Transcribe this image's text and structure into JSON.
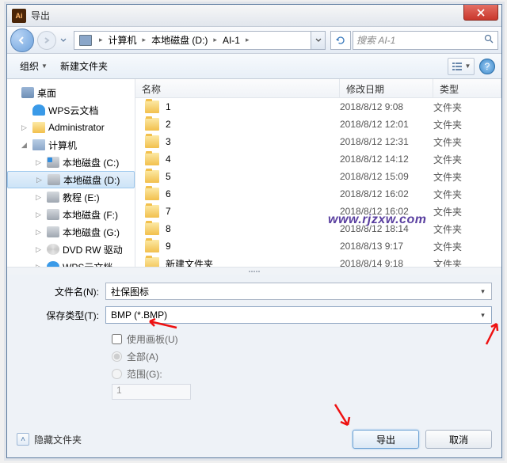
{
  "titlebar": {
    "title": "导出",
    "app_icon_text": "Ai"
  },
  "breadcrumb": {
    "seg1": "计算机",
    "seg2": "本地磁盘 (D:)",
    "seg3": "AI-1"
  },
  "search": {
    "placeholder": "搜索 AI-1"
  },
  "toolbar": {
    "organize": "组织",
    "new_folder": "新建文件夹",
    "help": "?"
  },
  "columns": {
    "name": "名称",
    "date": "修改日期",
    "type": "类型"
  },
  "sidebar": {
    "items": [
      {
        "label": "桌面",
        "icon": "ico-desktop",
        "lvl": "",
        "tri": ""
      },
      {
        "label": "WPS云文档",
        "icon": "ico-cloud",
        "lvl": "lvl1",
        "tri": ""
      },
      {
        "label": "Administrator",
        "icon": "ico-folder",
        "lvl": "lvl1",
        "tri": "▷"
      },
      {
        "label": "计算机",
        "icon": "ico-computer",
        "lvl": "lvl1",
        "tri": "◢"
      },
      {
        "label": "本地磁盘 (C:)",
        "icon": "ico-drive-win",
        "lvl": "lvl2",
        "tri": "▷"
      },
      {
        "label": "本地磁盘 (D:)",
        "icon": "ico-drive",
        "lvl": "lvl2",
        "tri": "▷",
        "sel": true
      },
      {
        "label": "教程 (E:)",
        "icon": "ico-drive",
        "lvl": "lvl2",
        "tri": "▷"
      },
      {
        "label": "本地磁盘 (F:)",
        "icon": "ico-drive",
        "lvl": "lvl2",
        "tri": "▷"
      },
      {
        "label": "本地磁盘 (G:)",
        "icon": "ico-drive",
        "lvl": "lvl2",
        "tri": "▷"
      },
      {
        "label": "DVD RW 驱动",
        "icon": "ico-dvd",
        "lvl": "lvl2",
        "tri": "▷"
      },
      {
        "label": "WPS云文档",
        "icon": "ico-cloud",
        "lvl": "lvl2",
        "tri": "▷"
      }
    ]
  },
  "files": [
    {
      "name": "1",
      "date": "2018/8/12 9:08",
      "type": "文件夹"
    },
    {
      "name": "2",
      "date": "2018/8/12 12:01",
      "type": "文件夹"
    },
    {
      "name": "3",
      "date": "2018/8/12 12:31",
      "type": "文件夹"
    },
    {
      "name": "4",
      "date": "2018/8/12 14:12",
      "type": "文件夹"
    },
    {
      "name": "5",
      "date": "2018/8/12 15:09",
      "type": "文件夹"
    },
    {
      "name": "6",
      "date": "2018/8/12 16:02",
      "type": "文件夹"
    },
    {
      "name": "7",
      "date": "2018/8/12 16:02",
      "type": "文件夹"
    },
    {
      "name": "8",
      "date": "2018/8/12 18:14",
      "type": "文件夹"
    },
    {
      "name": "9",
      "date": "2018/8/13 9:17",
      "type": "文件夹"
    },
    {
      "name": "新建文件夹",
      "date": "2018/8/14 9:18",
      "type": "文件夹"
    }
  ],
  "fields": {
    "filename_label": "文件名(N):",
    "filename_value": "社保图标",
    "savetype_label": "保存类型(T):",
    "savetype_value": "BMP (*.BMP)"
  },
  "options": {
    "use_artboard": "使用画板(U)",
    "all": "全部(A)",
    "range": "范围(G):",
    "range_value": "1"
  },
  "footer": {
    "hide_folders": "隐藏文件夹",
    "export": "导出",
    "cancel": "取消"
  },
  "watermark": "www.rjzxw.com"
}
